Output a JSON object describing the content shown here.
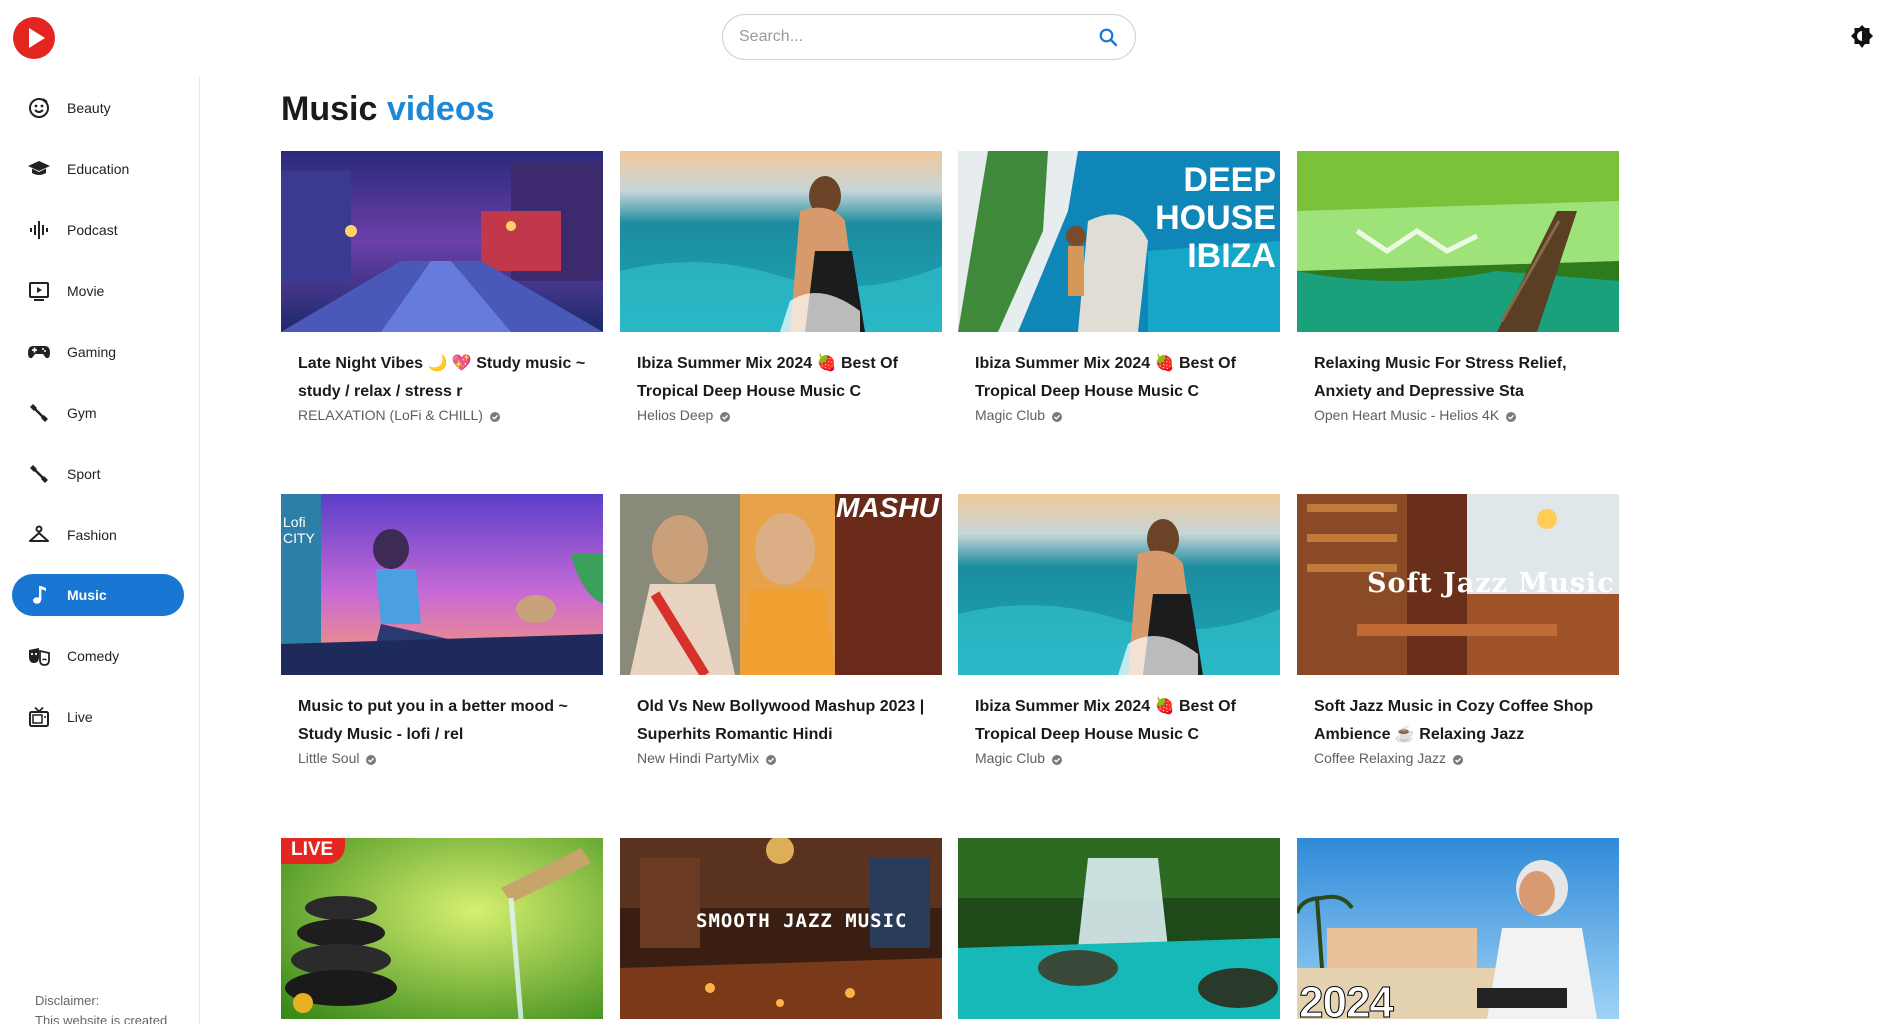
{
  "app": {
    "name": ""
  },
  "search": {
    "placeholder": "Search..."
  },
  "sidebar": {
    "items": [
      {
        "label": "Beauty",
        "icon": "smiley-icon"
      },
      {
        "label": "Education",
        "icon": "graduation-cap-icon"
      },
      {
        "label": "Podcast",
        "icon": "waveform-icon"
      },
      {
        "label": "Movie",
        "icon": "play-screen-icon"
      },
      {
        "label": "Gaming",
        "icon": "gamepad-icon"
      },
      {
        "label": "Gym",
        "icon": "dumbbell-icon"
      },
      {
        "label": "Sport",
        "icon": "dumbbell-icon"
      },
      {
        "label": "Fashion",
        "icon": "hanger-icon"
      },
      {
        "label": "Music",
        "icon": "music-note-icon",
        "active": true
      },
      {
        "label": "Comedy",
        "icon": "theater-masks-icon"
      },
      {
        "label": "Live",
        "icon": "tv-icon"
      }
    ],
    "disclaimer_line1": "Disclaimer:",
    "disclaimer_line2": "This website is created"
  },
  "main": {
    "title_part1": "Music",
    "title_part2": "videos",
    "accent_color": "#1e88d6"
  },
  "videos": [
    {
      "title": "Late Night Vibes 🌙 💖 Study music ~ study / relax / stress r",
      "channel": "RELAXATION (LoFi & CHILL)",
      "thumb_text": ""
    },
    {
      "title": "Ibiza Summer Mix 2024 🍓 Best Of Tropical Deep House Music C",
      "channel": "Helios Deep",
      "thumb_text": ""
    },
    {
      "title": "Ibiza Summer Mix 2024 🍓 Best Of Tropical Deep House Music C",
      "channel": "Magic Club",
      "thumb_text": "DEEP HOUSE IBIZA"
    },
    {
      "title": "Relaxing Music For Stress Relief, Anxiety and Depressive Sta",
      "channel": "Open Heart Music - Helios 4K",
      "thumb_text": ""
    },
    {
      "title": "Music to put you in a better mood ~ Study Music - lofi / rel",
      "channel": "Little Soul",
      "thumb_text": "Lofi CITY"
    },
    {
      "title": "Old Vs New Bollywood Mashup 2023 | Superhits Romantic Hindi",
      "channel": "New Hindi PartyMix",
      "thumb_text": "MASHU"
    },
    {
      "title": "Ibiza Summer Mix 2024 🍓 Best Of Tropical Deep House Music C",
      "channel": "Magic Club",
      "thumb_text": ""
    },
    {
      "title": "Soft Jazz Music in Cozy Coffee Shop Ambience ☕ Relaxing Jazz",
      "channel": "Coffee Relaxing Jazz",
      "thumb_text": "Soft Jazz Music"
    },
    {
      "title": "",
      "channel": "",
      "thumb_text": "LIVE"
    },
    {
      "title": "",
      "channel": "",
      "thumb_text": "SMOOTH JAZZ MUSIC"
    },
    {
      "title": "",
      "channel": "",
      "thumb_text": ""
    },
    {
      "title": "",
      "channel": "",
      "thumb_text": "2024"
    }
  ]
}
